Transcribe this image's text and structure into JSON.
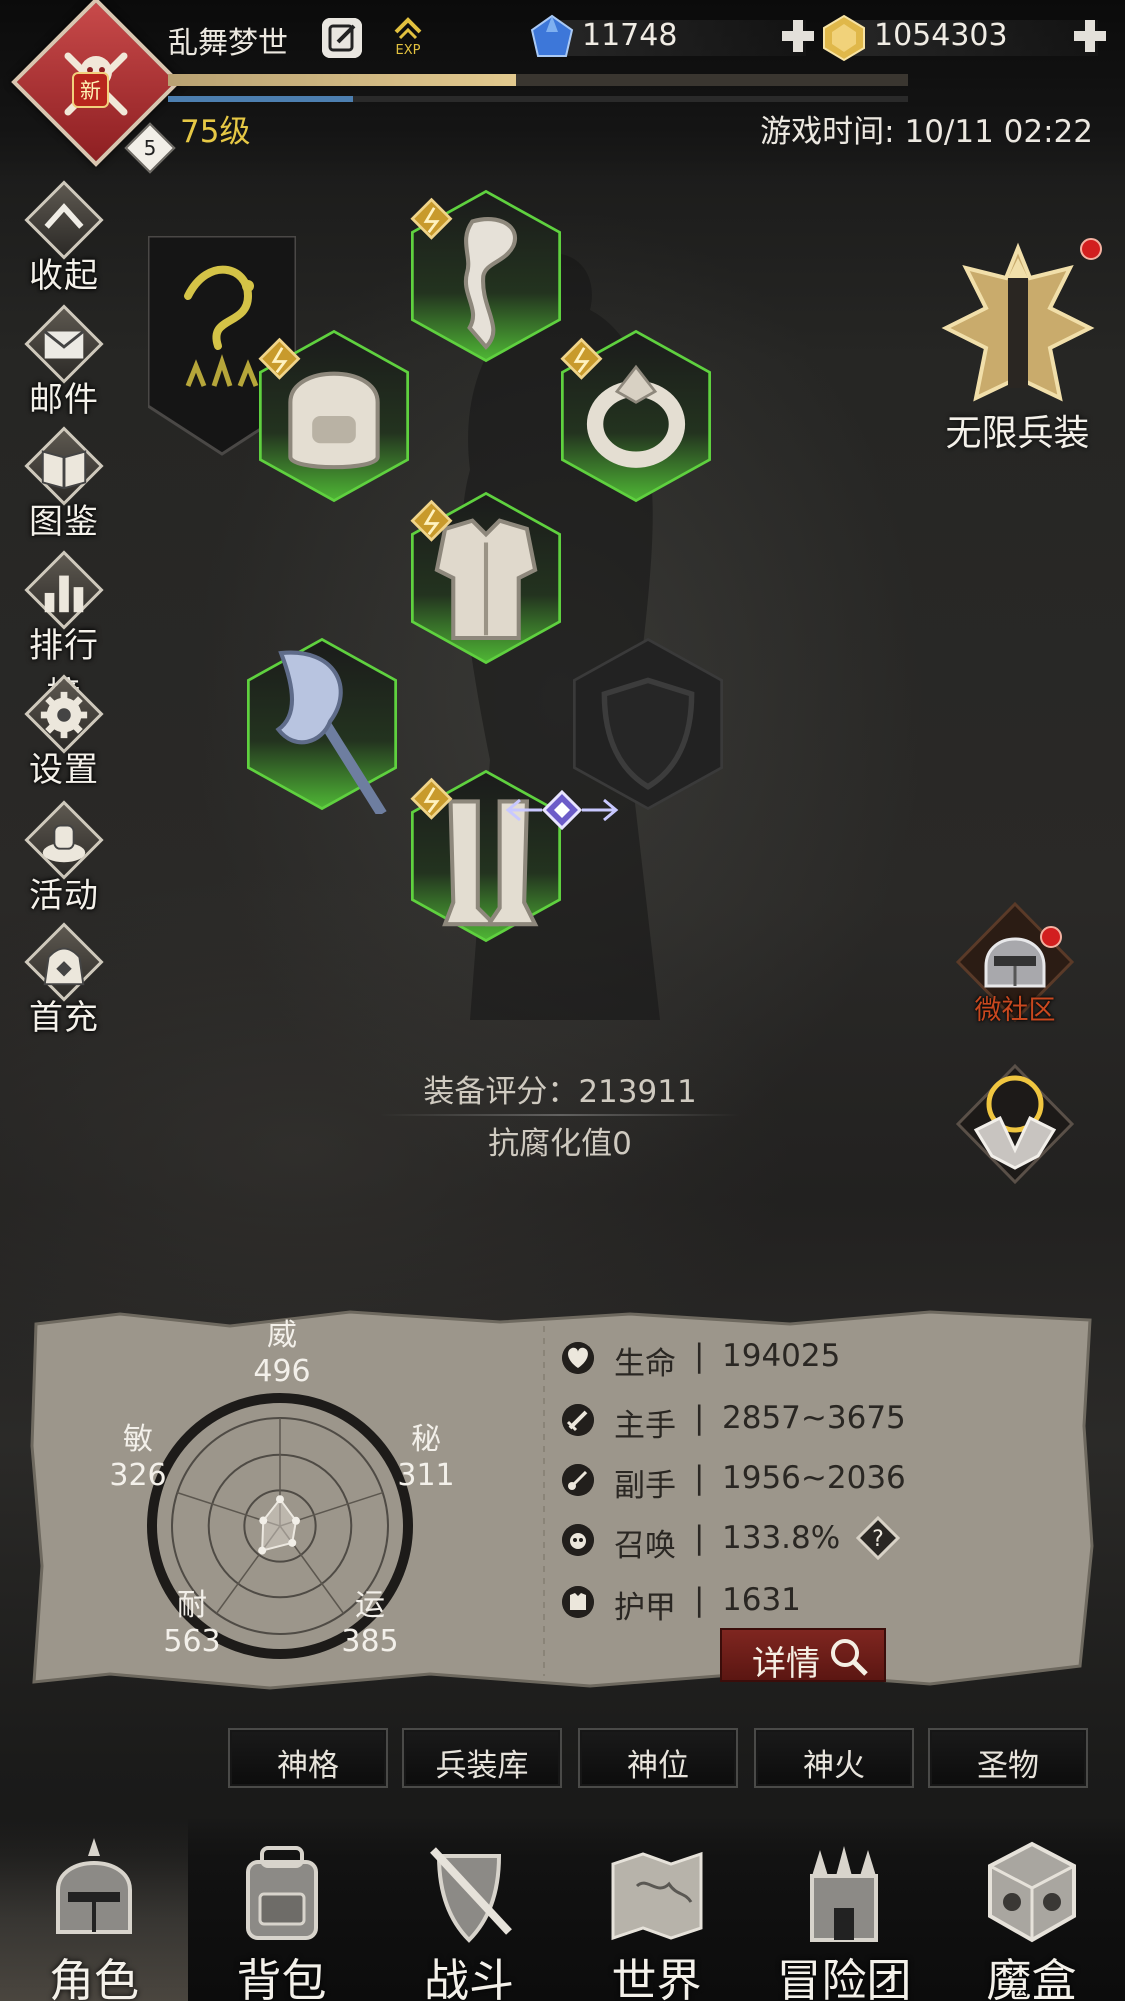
{
  "player": {
    "name": "乱舞梦世",
    "level_label": "75级",
    "badge_level": "5",
    "new_tag": "新",
    "exp_icon_text": "EXP",
    "exp_progress": 0.47,
    "mp_progress": 0.25
  },
  "currencies": [
    {
      "name": "diamond",
      "value": "11748",
      "icon": "blue-gem-icon",
      "color": "#3d77d9"
    },
    {
      "name": "gold",
      "value": "1054303",
      "icon": "gold-gem-icon",
      "color": "#e0b84a"
    }
  ],
  "game_time": "游戏时间: 10/11 02:22",
  "side_menu": [
    {
      "id": "collapse",
      "label": "收起",
      "icon": "collapse-arrow-icon"
    },
    {
      "id": "mail",
      "label": "邮件",
      "icon": "mail-icon"
    },
    {
      "id": "codex",
      "label": "图鉴",
      "icon": "book-icon"
    },
    {
      "id": "ranking",
      "label": "排行榜",
      "icon": "bar-chart-icon"
    },
    {
      "id": "settings",
      "label": "设置",
      "icon": "gear-icon"
    },
    {
      "id": "events",
      "label": "活动",
      "icon": "event-icon"
    },
    {
      "id": "first-recharge",
      "label": "首充",
      "icon": "bag-icon"
    }
  ],
  "right_panel": {
    "infinite_label": "无限兵装",
    "micro_label": "微社区"
  },
  "equipment": {
    "slots": [
      {
        "id": "neck",
        "icon": "scarf-icon",
        "equipped": true
      },
      {
        "id": "head",
        "icon": "helmet-icon",
        "equipped": true
      },
      {
        "id": "ring",
        "icon": "ring-icon",
        "equipped": true
      },
      {
        "id": "body",
        "icon": "armor-icon",
        "equipped": true
      },
      {
        "id": "weapon",
        "icon": "axe-icon",
        "equipped": true
      },
      {
        "id": "offhand",
        "icon": "shield-icon",
        "equipped": false
      },
      {
        "id": "legs",
        "icon": "greaves-icon",
        "equipped": true
      }
    ],
    "score": "装备评分：213911",
    "corruption": "抗腐化值0"
  },
  "radar": {
    "stats": [
      {
        "name": "威",
        "value": 496
      },
      {
        "name": "秘",
        "value": 311
      },
      {
        "name": "运",
        "value": 385
      },
      {
        "name": "耐",
        "value": 563
      },
      {
        "name": "敏",
        "value": 326
      }
    ]
  },
  "stats": [
    {
      "name": "生命",
      "sep": "|",
      "value": "194025",
      "icon": "heart-icon"
    },
    {
      "name": "主手",
      "sep": "|",
      "value": "2857~3675",
      "icon": "sword-icon"
    },
    {
      "name": "副手",
      "sep": "|",
      "value": "1956~2036",
      "icon": "dagger-icon"
    },
    {
      "name": "召唤",
      "sep": "|",
      "value": "133.8%",
      "icon": "summon-icon"
    },
    {
      "name": "护甲",
      "sep": "|",
      "value": "1631",
      "icon": "armor-small-icon"
    }
  ],
  "help_symbol": "?",
  "detail_button": "详情",
  "sub_tabs": [
    "神格",
    "兵装库",
    "神位",
    "神火",
    "圣物"
  ],
  "bottom_nav": [
    {
      "label": "角色",
      "icon": "knight-helmet-icon",
      "active": true
    },
    {
      "label": "背包",
      "icon": "backpack-icon",
      "active": false
    },
    {
      "label": "战斗",
      "icon": "sword-shield-icon",
      "active": false
    },
    {
      "label": "世界",
      "icon": "map-icon",
      "active": false
    },
    {
      "label": "冒险团",
      "icon": "castle-icon",
      "active": false
    },
    {
      "label": "魔盒",
      "icon": "magic-cube-icon",
      "active": false
    }
  ],
  "colors": {
    "accent_gold": "#e6c845",
    "equip_green": "#5fd13f",
    "danger_red": "#d21f1f",
    "button_red": "#7f2620"
  }
}
